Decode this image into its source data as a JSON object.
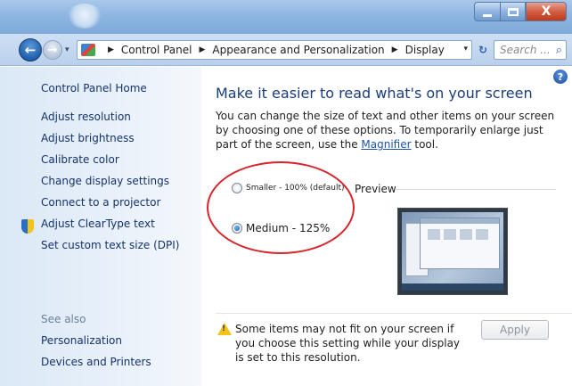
{
  "window": {
    "minimize_glyph": "_",
    "close_glyph": "X"
  },
  "nav": {
    "back_glyph": "←",
    "forward_glyph": "→",
    "history_glyph": "▾",
    "breadcrumbs": [
      "Control Panel",
      "Appearance and Personalization",
      "Display"
    ],
    "breadcrumb_separator": "▶",
    "address_dropdown_glyph": "▾",
    "refresh_glyph": "↻",
    "search_placeholder": "Search ...",
    "search_icon": "search-icon"
  },
  "sidebar": {
    "home": "Control Panel Home",
    "links": [
      "Adjust resolution",
      "Adjust brightness",
      "Calibrate color",
      "Change display settings",
      "Connect to a projector",
      "Adjust ClearType text",
      "Set custom text size (DPI)"
    ],
    "calibrate_icon": "shield-icon",
    "see_also": "See also",
    "see_also_links": [
      "Personalization",
      "Devices and Printers"
    ]
  },
  "main": {
    "help_glyph": "?",
    "heading": "Make it easier to read what's on your screen",
    "description_before": "You can change the size of text and other items on your screen by choosing one of these options. To temporarily enlarge just part of the screen, use the ",
    "description_link": "Magnifier",
    "description_after": " tool.",
    "options": [
      {
        "label": "Smaller - 100% (default)",
        "selected": false
      },
      {
        "label": "Medium - 125%",
        "selected": true
      }
    ],
    "preview_label": "Preview",
    "warning_glyph": "!",
    "warning_text": "Some items may not fit on your screen if you choose this setting while your display is set to this resolution.",
    "apply_label": "Apply",
    "apply_enabled": false
  },
  "colors": {
    "annotation_circle": "#d8232a",
    "link": "#16326a",
    "heading": "#1b3d7a",
    "warning": "#f3c21c"
  }
}
